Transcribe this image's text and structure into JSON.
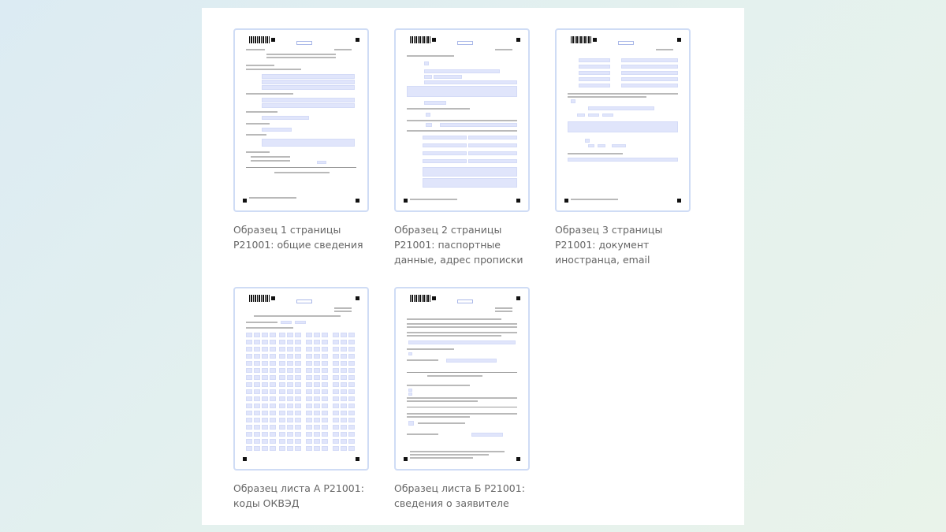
{
  "samples": [
    {
      "caption": "Образец 1 страницы Р21001: общие сведения"
    },
    {
      "caption": "Образец 2 страницы Р21001: паспортные данные, адрес прописки"
    },
    {
      "caption": "Образец 3 страницы Р21001: документ иностранца, email"
    },
    {
      "caption": "Образец листа А Р21001: коды ОКВЭД"
    },
    {
      "caption": "Образец листа Б Р21001: сведения о заявителе"
    }
  ],
  "colors": {
    "background": "#dcebf3",
    "thumb_border": "#cfdcf5",
    "field_fill": "#e0e5fb",
    "caption_text": "#666666"
  },
  "icons": [
    "barcode-icon",
    "corner-marker-icon"
  ]
}
